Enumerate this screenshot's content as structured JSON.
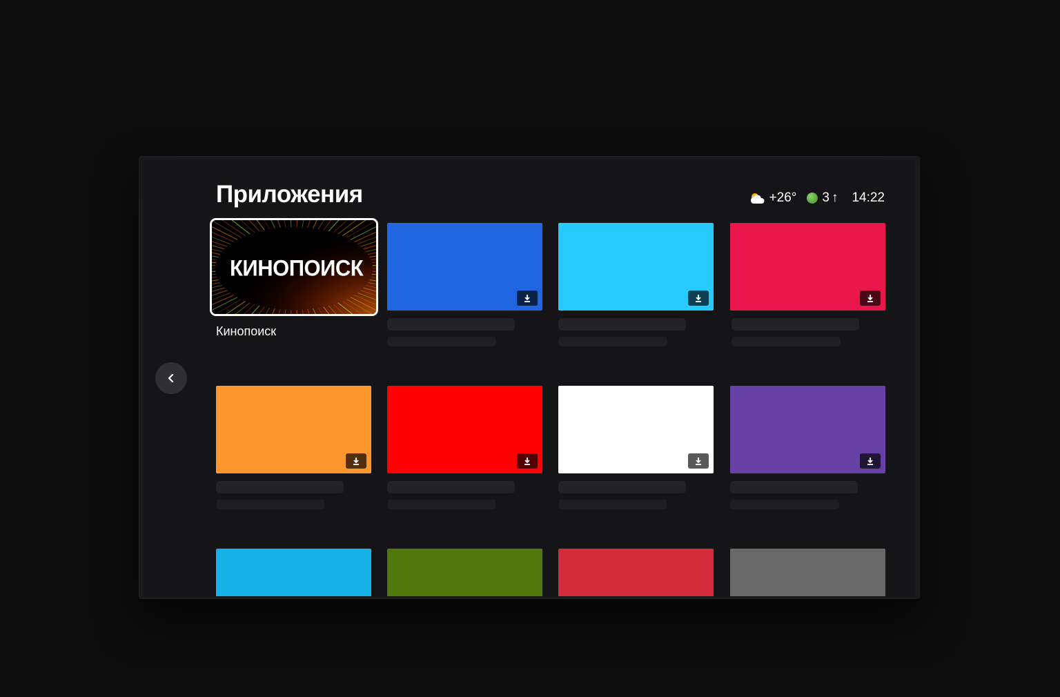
{
  "header": {
    "title": "Приложения",
    "weather_icon": "partly-cloudy-icon",
    "temperature": "+26°",
    "alice_icon": "alice-orb-icon",
    "notification_count": "3",
    "arrow_glyph": "↑",
    "time": "14:22"
  },
  "focused_app": {
    "logo_text": "КИНОПОИСК",
    "label": "Кинопоиск"
  },
  "tiles": [
    {
      "color": "#000000",
      "focused": true
    },
    {
      "color": "#2066e0",
      "download": true
    },
    {
      "color": "#26cbfb",
      "download": true
    },
    {
      "color": "#ea174d",
      "download": true
    },
    {
      "color": "#fd962d",
      "download": true
    },
    {
      "color": "#fe0000",
      "download": true
    },
    {
      "color": "#ffffff",
      "download": true
    },
    {
      "color": "#6741a6",
      "download": true
    },
    {
      "color": "#16b1e7",
      "download": false
    },
    {
      "color": "#52790d",
      "download": false
    },
    {
      "color": "#d32b39",
      "download": false
    },
    {
      "color": "#696969",
      "download": false
    }
  ],
  "colors": {
    "background": "#0c0c0d",
    "screen": "#151517",
    "placeholder": "#232325"
  },
  "icons": {
    "download": "download-icon",
    "back": "chevron-left-icon"
  }
}
